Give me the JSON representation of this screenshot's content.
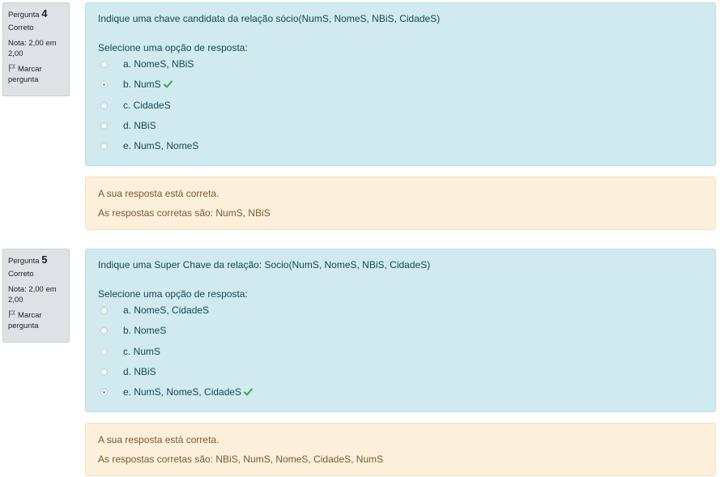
{
  "questions": [
    {
      "info": {
        "label": "Pergunta",
        "number": "4",
        "state": "Correto",
        "grade": "Nota: 2,00 em 2,00",
        "flag_label": "Marcar pergunta",
        "flag_icon": "flag-icon"
      },
      "text": "Indique uma chave candidata da relação sócio(NumS, NomeS, NBiS, CidadeS)",
      "prompt": "Selecione uma opção de resposta:",
      "options": [
        {
          "label": "a. NomeS, NBiS",
          "checked": false,
          "correct_mark": false
        },
        {
          "label": "b. NumS",
          "checked": true,
          "correct_mark": true
        },
        {
          "label": "c. CidadeS",
          "checked": false,
          "correct_mark": false
        },
        {
          "label": "d. NBiS",
          "checked": false,
          "correct_mark": false
        },
        {
          "label": "e. NumS, NomeS",
          "checked": false,
          "correct_mark": false
        }
      ],
      "outcome": {
        "feedback": "A sua resposta está correta.",
        "right_answer": "As respostas corretas são: NumS, NBiS"
      }
    },
    {
      "info": {
        "label": "Pergunta",
        "number": "5",
        "state": "Correto",
        "grade": "Nota: 2,00 em 2,00",
        "flag_label": "Marcar pergunta",
        "flag_icon": "flag-icon"
      },
      "text": "Indique uma Super Chave da relação:  Socio(NumS, NomeS, NBiS, CidadeS)",
      "prompt": "Selecione uma opção de resposta:",
      "options": [
        {
          "label": "a. NomeS, CidadeS",
          "checked": false,
          "correct_mark": false
        },
        {
          "label": "b. NomeS",
          "checked": false,
          "correct_mark": false
        },
        {
          "label": "c. NumS",
          "checked": false,
          "correct_mark": false
        },
        {
          "label": "d. NBiS",
          "checked": false,
          "correct_mark": false
        },
        {
          "label": "e. NumS, NomeS, CidadeS",
          "checked": true,
          "correct_mark": true
        }
      ],
      "outcome": {
        "feedback": "A sua resposta está correta.",
        "right_answer": "As respostas corretas são: NBiS, NumS, NomeS, CidadeS, NumS"
      }
    }
  ],
  "colors": {
    "formulation_bg": "#d0eaf0",
    "outcome_bg": "#fcefdc",
    "info_bg": "#dee2e6",
    "correct_check": "#3fa741"
  }
}
